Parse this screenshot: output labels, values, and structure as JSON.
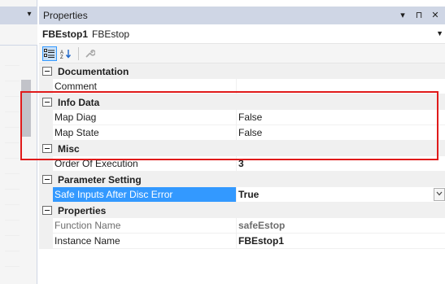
{
  "left_panel": {
    "dropdown_glyph": "▾"
  },
  "properties_panel": {
    "title": "Properties",
    "title_buttons": [
      "▾",
      "⊓",
      "✕"
    ],
    "object": {
      "name": "FBEstop1",
      "type": "FBEstop"
    },
    "toolbar": {
      "categorized_icon": "categorized-icon",
      "alphabetical_icon": "alphabetical-icon",
      "alphabetical_glyph": "A↓",
      "property_pages_icon": "wrench-icon"
    },
    "categories": [
      {
        "label": "Documentation",
        "properties": [
          {
            "name": "Comment",
            "value": ""
          }
        ]
      },
      {
        "label": "Info Data",
        "properties": [
          {
            "name": "Map Diag",
            "value": "False"
          },
          {
            "name": "Map State",
            "value": "False"
          }
        ]
      },
      {
        "label": "Misc",
        "properties": [
          {
            "name": "Order Of Execution",
            "value": "3"
          }
        ]
      },
      {
        "label": "Parameter Setting",
        "properties": [
          {
            "name": "Safe Inputs After Disc Error",
            "value": "True"
          }
        ]
      },
      {
        "label": "Properties",
        "properties": [
          {
            "name": "Function Name",
            "value": "safeEstop"
          },
          {
            "name": "Instance Name",
            "value": "FBEstop1"
          }
        ]
      }
    ]
  },
  "colors": {
    "titlebar": "#cfd6e5",
    "selection": "#3399ff",
    "highlight_box": "#e01b1b"
  }
}
